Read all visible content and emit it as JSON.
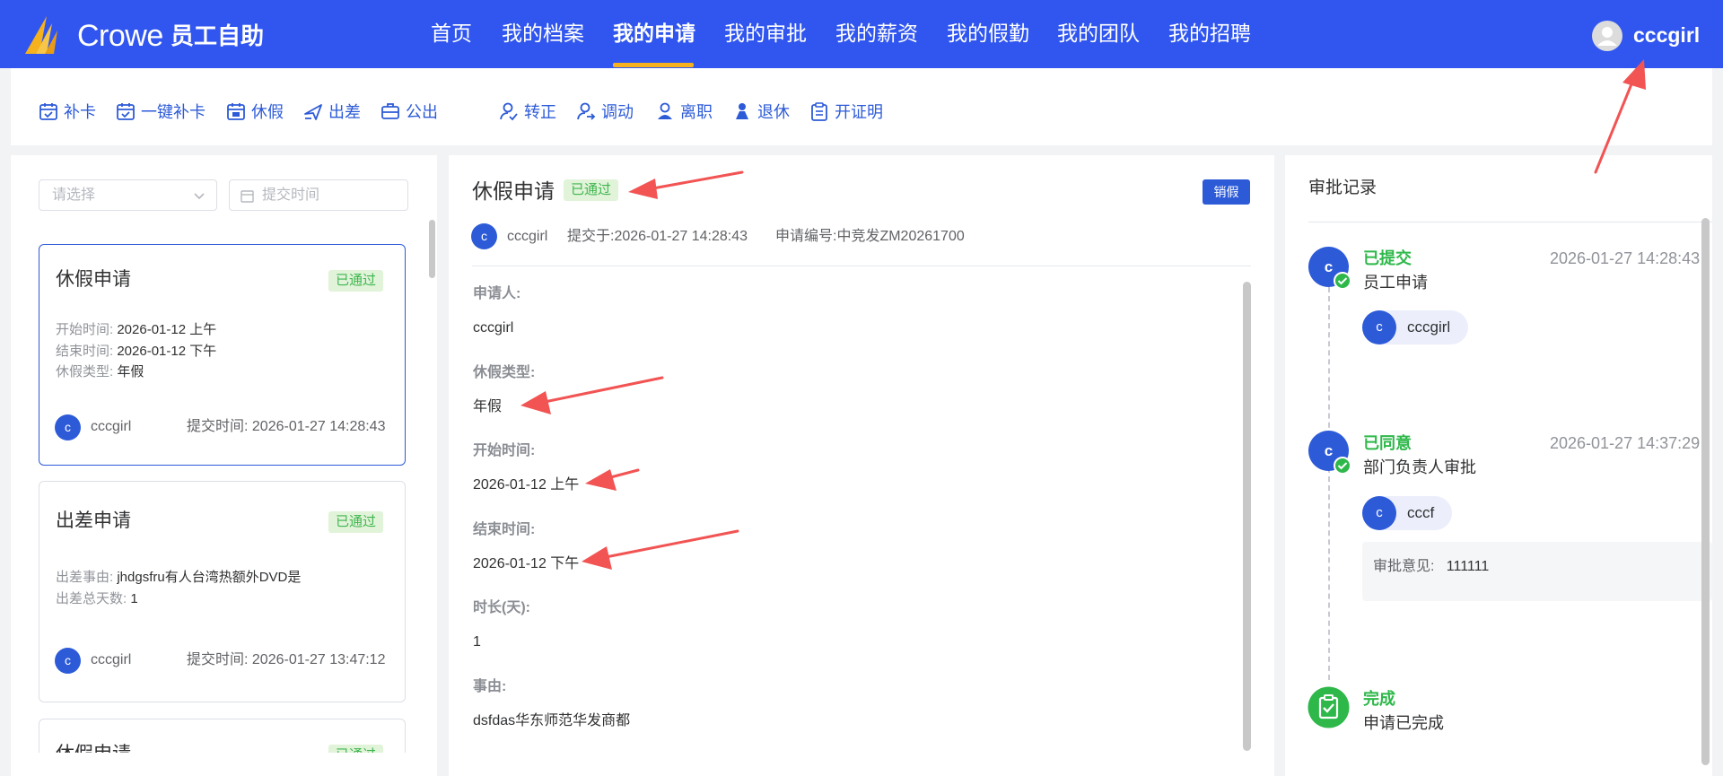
{
  "header": {
    "brand": "Crowe",
    "brand_sub": "员工自助",
    "nav": [
      "首页",
      "我的档案",
      "我的申请",
      "我的审批",
      "我的薪资",
      "我的假勤",
      "我的团队",
      "我的招聘"
    ],
    "active_nav": "我的申请",
    "username": "cccgirl",
    "colors": {
      "header_bg": "#3056ef",
      "active_underline": "#f5b21e"
    }
  },
  "toolbar": {
    "items": [
      {
        "label": "补卡",
        "icon": "calendar-check-icon"
      },
      {
        "label": "一键补卡",
        "icon": "calendar-check-icon"
      },
      {
        "label": "休假",
        "icon": "calendar-leave-icon"
      },
      {
        "label": "出差",
        "icon": "plane-icon"
      },
      {
        "label": "公出",
        "icon": "briefcase-icon"
      },
      {
        "label": "转正",
        "icon": "user-check-icon"
      },
      {
        "label": "调动",
        "icon": "user-transfer-icon"
      },
      {
        "label": "离职",
        "icon": "user-leave-icon"
      },
      {
        "label": "退休",
        "icon": "user-retire-icon"
      },
      {
        "label": "开证明",
        "icon": "clipboard-icon"
      }
    ]
  },
  "filters": {
    "select_placeholder": "请选择",
    "date_placeholder": "提交时间"
  },
  "list": {
    "cards": [
      {
        "title": "休假申请",
        "status": "已通过",
        "fields": [
          {
            "k": "开始时间:",
            "v": "2026-01-12 上午"
          },
          {
            "k": "结束时间:",
            "v": "2026-01-12 下午"
          },
          {
            "k": "休假类型:",
            "v": "年假"
          }
        ],
        "avatar": "c",
        "user": "cccgirl",
        "submit_label": "提交时间:",
        "submit_time": "2026-01-27 14:28:43"
      },
      {
        "title": "出差申请",
        "status": "已通过",
        "fields": [
          {
            "k": "出差事由:",
            "v": "jhdgsfru有人台湾热额外DVD是"
          },
          {
            "k": "出差总天数:",
            "v": "1"
          }
        ],
        "avatar": "c",
        "user": "cccgirl",
        "submit_label": "提交时间:",
        "submit_time": "2026-01-27 13:47:12"
      },
      {
        "title": "休假申请",
        "status": "已通过"
      }
    ]
  },
  "detail": {
    "title": "休假申请",
    "status": "已通过",
    "cancel_button": "销假",
    "avatar": "c",
    "user": "cccgirl",
    "submitted_label": "提交于:",
    "submitted_time": "2026-01-27 14:28:43",
    "number_label": "申请编号:",
    "number": "中竞发ZM20261700",
    "fields": [
      {
        "label": "申请人:",
        "value": "cccgirl"
      },
      {
        "label": "休假类型:",
        "value": "年假"
      },
      {
        "label": "开始时间:",
        "value": "2026-01-12 上午"
      },
      {
        "label": "结束时间:",
        "value": "2026-01-12 下午"
      },
      {
        "label": "时长(天):",
        "value": "1"
      },
      {
        "label": "事由:",
        "value": "dsfdas华东师范华发商都"
      }
    ]
  },
  "audit": {
    "title": "审批记录",
    "steps": [
      {
        "avatar": "c",
        "status": "已提交",
        "desc": "员工申请",
        "time": "2026-01-27 14:28:43",
        "chip_avatar": "c",
        "chip_name": "cccgirl"
      },
      {
        "avatar": "c",
        "status": "已同意",
        "desc": "部门负责人审批",
        "time": "2026-01-27 14:37:29",
        "chip_avatar": "c",
        "chip_name": "cccf",
        "comment_label": "审批意见:",
        "comment": "111111"
      },
      {
        "status": "完成",
        "desc": "申请已完成",
        "icon": "clipboard-done-icon"
      }
    ],
    "colors": {
      "success": "#2eb84a",
      "primary": "#2d5bd8"
    }
  }
}
